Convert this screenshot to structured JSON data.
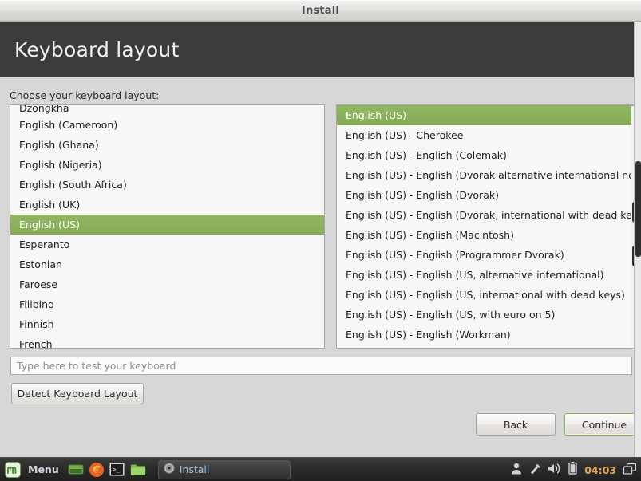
{
  "window": {
    "title": "Install"
  },
  "header": {
    "page_title": "Keyboard layout",
    "background_color": "#3b3b39"
  },
  "main": {
    "instruction_label": "Choose your keyboard layout:",
    "accent_color": "#8cb25c",
    "layout_list": {
      "name": "keyboard-layout-list",
      "selected": "English (US)",
      "clipped_top_item": "Dzongkha",
      "clipped_bottom_item": "French",
      "items": [
        "Dzongkha",
        "English (Cameroon)",
        "English (Ghana)",
        "English (Nigeria)",
        "English (South Africa)",
        "English (UK)",
        "English (US)",
        "Esperanto",
        "Estonian",
        "Faroese",
        "Filipino",
        "Finnish",
        "French"
      ]
    },
    "variant_list": {
      "name": "keyboard-variant-list",
      "selected": "English (US)",
      "items": [
        "English (US)",
        "English (US) - Cherokee",
        "English (US) - English (Colemak)",
        "English (US) - English (Dvorak alternative international no dead keys)",
        "English (US) - English (Dvorak)",
        "English (US) - English (Dvorak, international with dead keys)",
        "English (US) - English (Macintosh)",
        "English (US) - English (Programmer Dvorak)",
        "English (US) - English (US, alternative international)",
        "English (US) - English (US, international with dead keys)",
        "English (US) - English (US, with euro on 5)",
        "English (US) - English (Workman)"
      ]
    },
    "test_input": {
      "value": "",
      "placeholder": "Type here to test your keyboard"
    },
    "detect_button_label": "Detect Keyboard Layout"
  },
  "footer": {
    "back_label": "Back",
    "continue_label": "Continue",
    "continue_border_color": "#86b252"
  },
  "taskbar": {
    "menu_label": "Menu",
    "launchers": [
      "show-desktop-icon",
      "firefox-icon",
      "terminal-icon",
      "file-manager-icon"
    ],
    "task_button_label": "Install",
    "tray": {
      "user_icon": "user-icon",
      "update_icon": "update-manager-icon",
      "volume_icon": "volume-icon",
      "battery_icon": "battery-icon",
      "clock": "04:03",
      "workspace_icon": "workspace-switcher-icon"
    }
  }
}
